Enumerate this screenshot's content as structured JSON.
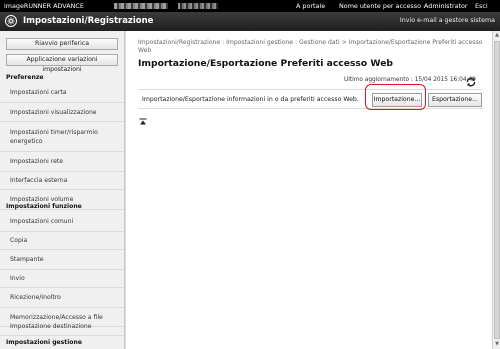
{
  "topbar": {
    "brand": "imageRUNNER ADVANCE",
    "portal_link": "A portale",
    "user_label": "Nome utente per accesso :",
    "username": "Administrator",
    "logout": "Esci"
  },
  "titlebar": {
    "title": "Impostazioni/Registrazione",
    "email_link": "Invio e-mail a gestore sistema"
  },
  "sidebar": {
    "restart_button": "Riavvio periferica",
    "apply_button": "Applicazione variazioni impostazioni",
    "section_preferenze": "Preferenze",
    "preferenze_items": [
      "Impostazioni carta",
      "Impostazioni visualizzazione",
      "Impostazioni timer/risparmio energetico",
      "Impostazioni rete",
      "Interfaccia esterna",
      "Impostazioni volume"
    ],
    "section_funzione": "Impostazioni funzione",
    "funzione_items": [
      "Impostazioni comuni",
      "Copia",
      "Stampante",
      "Invio",
      "Ricezione/Inoltro",
      "Memorizzazione/Accesso a file",
      "Impostazione destinazione"
    ],
    "section_gestione": "Impostazioni gestione"
  },
  "main": {
    "breadcrumb": "Impostazioni/Registrazione : Impostazioni gestione : Gestione dati > Importazione/Esportazione Preferiti accesso Web",
    "title": "Importazione/Esportazione Preferiti accesso Web",
    "last_updated": "Ultimo aggiornamento : 15/04 2015 16:04:49",
    "description": "Importazione/Esportazione informazioni in o da preferiti accesso Web.",
    "import_button": "Importazione...",
    "export_button": "Esportazione..."
  },
  "colors": {
    "highlight": "#e0141e",
    "titlebar": "#2a2a2a"
  }
}
